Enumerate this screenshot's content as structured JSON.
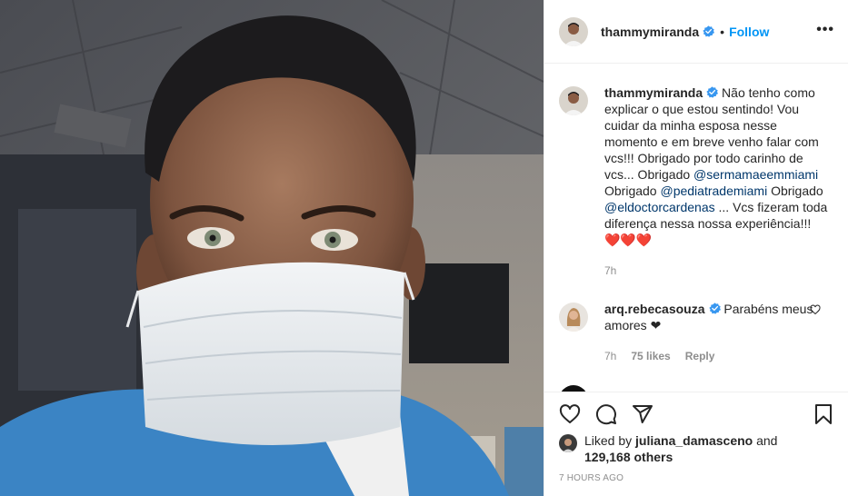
{
  "post": {
    "author": {
      "username": "thammymiranda",
      "verified": true,
      "follow_label": "Follow",
      "separator": "•",
      "more_label": "•••"
    },
    "caption": {
      "username": "thammymiranda",
      "text_1": "Não tenho como explicar o que estou sentindo! Vou cuidar da minha esposa nesse momento e em breve venho falar com vcs!!! Obrigado por todo carinho de vcs... Obrigado ",
      "mention_1": "@sermamaeemmiami",
      "text_2": " Obrigado ",
      "mention_2": "@pediatrademiami",
      "text_3": " Obrigado ",
      "mention_3": "@eldoctorcardenas",
      "text_4": " ... Vcs fizeram toda diferença nessa nossa experiência!!! ❤️❤️❤️",
      "time": "7h"
    },
    "comments": [
      {
        "username": "arq.rebecasouza",
        "verified": true,
        "text": "Parabéns meus amores ❤",
        "time": "7h",
        "likes": "75 likes",
        "reply_label": "Reply"
      }
    ],
    "liked_by": {
      "prefix": "Liked by ",
      "user": "juliana_damasceno",
      "middle": " and",
      "others": "129,168 others"
    },
    "timestamp": "7 HOURS AGO",
    "colors": {
      "accent": "#0095f6",
      "mention": "#00376b",
      "meta": "#8e8e8e",
      "heart": "#ed4956"
    },
    "icons": [
      "heart-icon",
      "comment-icon",
      "share-icon",
      "bookmark-icon",
      "verified-badge-icon",
      "more-icon"
    ]
  }
}
